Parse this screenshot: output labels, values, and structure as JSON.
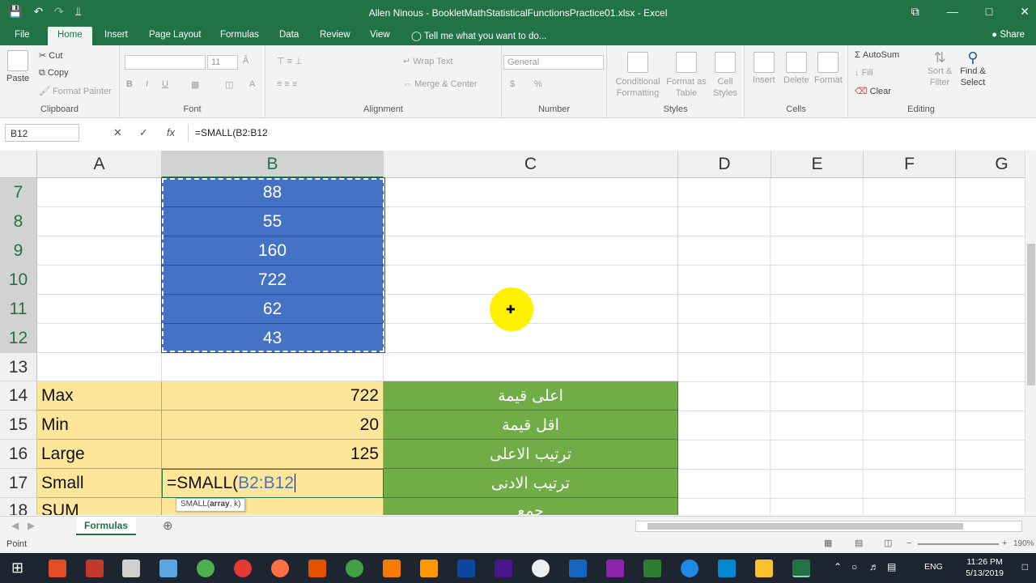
{
  "window": {
    "title": "Allen Ninous - BookletMathStatisticalFunctionsPractice01.xlsx - Excel",
    "controls": [
      "⧉",
      "—",
      "□",
      "✕"
    ]
  },
  "qat": {
    "save": "💾",
    "undo": "↶",
    "redo": "↷",
    "more": "⫫"
  },
  "tabs": {
    "file": "File",
    "home": "Home",
    "insert": "Insert",
    "page_layout": "Page Layout",
    "formulas": "Formulas",
    "data": "Data",
    "review": "Review",
    "view": "View",
    "tell_me": "Tell me what you want to do...",
    "share": "Share"
  },
  "ribbon": {
    "clipboard": {
      "label": "Clipboard",
      "paste": "Paste",
      "cut": "Cut",
      "copy": "Copy",
      "format_painter": "Format Painter"
    },
    "font": {
      "label": "Font",
      "size": "11",
      "bold": "B",
      "italic": "I",
      "underline": "U"
    },
    "alignment": {
      "label": "Alignment",
      "wrap_text": "Wrap Text",
      "merge_center": "Merge & Center"
    },
    "number": {
      "label": "Number",
      "format": "General",
      "currency": "$",
      "percent": "%"
    },
    "styles": {
      "label": "Styles",
      "conditional": "Conditional Formatting",
      "format_table": "Format as Table",
      "cell_styles": "Cell Styles"
    },
    "cells": {
      "label": "Cells",
      "insert": "Insert",
      "delete": "Delete",
      "format": "Format"
    },
    "editing": {
      "label": "Editing",
      "autosum": "AutoSum",
      "fill": "Fill",
      "clear": "Clear",
      "sort_filter": "Sort & Filter",
      "find_select": "Find & Select"
    }
  },
  "formula_bar": {
    "name_box": "B12",
    "cancel": "✕",
    "enter": "✓",
    "fx": "fx",
    "formula": "=SMALL(B2:B12"
  },
  "columns": [
    "A",
    "B",
    "C",
    "D",
    "E",
    "F",
    "G"
  ],
  "rows": {
    "r7": {
      "num": "7",
      "b": "88"
    },
    "r8": {
      "num": "8",
      "b": "55"
    },
    "r9": {
      "num": "9",
      "b": "160"
    },
    "r10": {
      "num": "10",
      "b": "722"
    },
    "r11": {
      "num": "11",
      "b": "62"
    },
    "r12": {
      "num": "12",
      "b": "43"
    },
    "r13": {
      "num": "13"
    },
    "r14": {
      "num": "14",
      "a": "Max",
      "b": "722",
      "c": "اعلى قيمة"
    },
    "r15": {
      "num": "15",
      "a": "Min",
      "b": "20",
      "c": "اقل قيمة"
    },
    "r16": {
      "num": "16",
      "a": "Large",
      "b": "125",
      "c": "ترتيب الاعلى"
    },
    "r17": {
      "num": "17",
      "a": "Small",
      "b_prefix": "=SMALL(",
      "b_ref": "B2:B12",
      "c": "ترتيب الادنى"
    },
    "r18": {
      "num": "18",
      "a": "SUM",
      "c": "جمع"
    }
  },
  "tooltip": {
    "fn": "SMALL(",
    "arg1": "array",
    "rest": ", k)"
  },
  "sheet": {
    "tab": "Formulas",
    "add": "⊕"
  },
  "status": {
    "mode": "Point",
    "zoom": "190%"
  },
  "taskbar": {
    "time": "11:26 PM",
    "date": "5/13/2019",
    "lang": "ENG"
  },
  "colors": {
    "excel_green": "#217346",
    "selection_blue": "#4472c4",
    "label_tan": "#ffe699",
    "arabic_green": "#70ad47",
    "cursor_yellow": "#fff100"
  }
}
